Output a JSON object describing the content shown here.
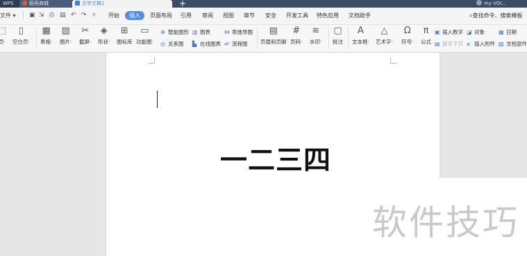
{
  "titlebar": {
    "app_tab": "WPS",
    "store_tab": "稻壳商城",
    "doc_tab": "文字文稿1",
    "new_tab": "+",
    "user": "my VOI..."
  },
  "menubar": {
    "file": "文件 ▾",
    "tabs": [
      "开始",
      "插入",
      "页面布局",
      "引用",
      "审阅",
      "视图",
      "章节",
      "安全",
      "开发工具",
      "特色应用",
      "文档助手"
    ],
    "active_tab": "插入",
    "search": "查找命令、搜索模板"
  },
  "ribbon": {
    "page_partial": "页·",
    "blank_page": "空白页·",
    "table": "表格·",
    "picture": "图片·",
    "screenshot": "截屏·",
    "shape": "形状·",
    "icon_lib": "图标库",
    "func_chart": "功能图·",
    "smart_graphic": "智能图形",
    "chart": "图表",
    "mindmap": "思维导图",
    "relation": "关系图",
    "online_chart": "在线图表",
    "flowchart": "流程图",
    "header_footer": "页眉和页脚",
    "page_number": "页码·",
    "watermark_btn": "水印·",
    "comment": "批注",
    "textbox": "文本框·",
    "wordart": "艺术字·",
    "symbol": "符号·",
    "formula": "公式",
    "insert_number": "插入数字",
    "first_drop": "首字下沉",
    "object": "对象·",
    "attachment": "插入附件",
    "date": "日期",
    "doc_parts": "文档部件"
  },
  "document": {
    "text": "一二三四"
  },
  "overlay": {
    "watermark": "软件技巧"
  }
}
